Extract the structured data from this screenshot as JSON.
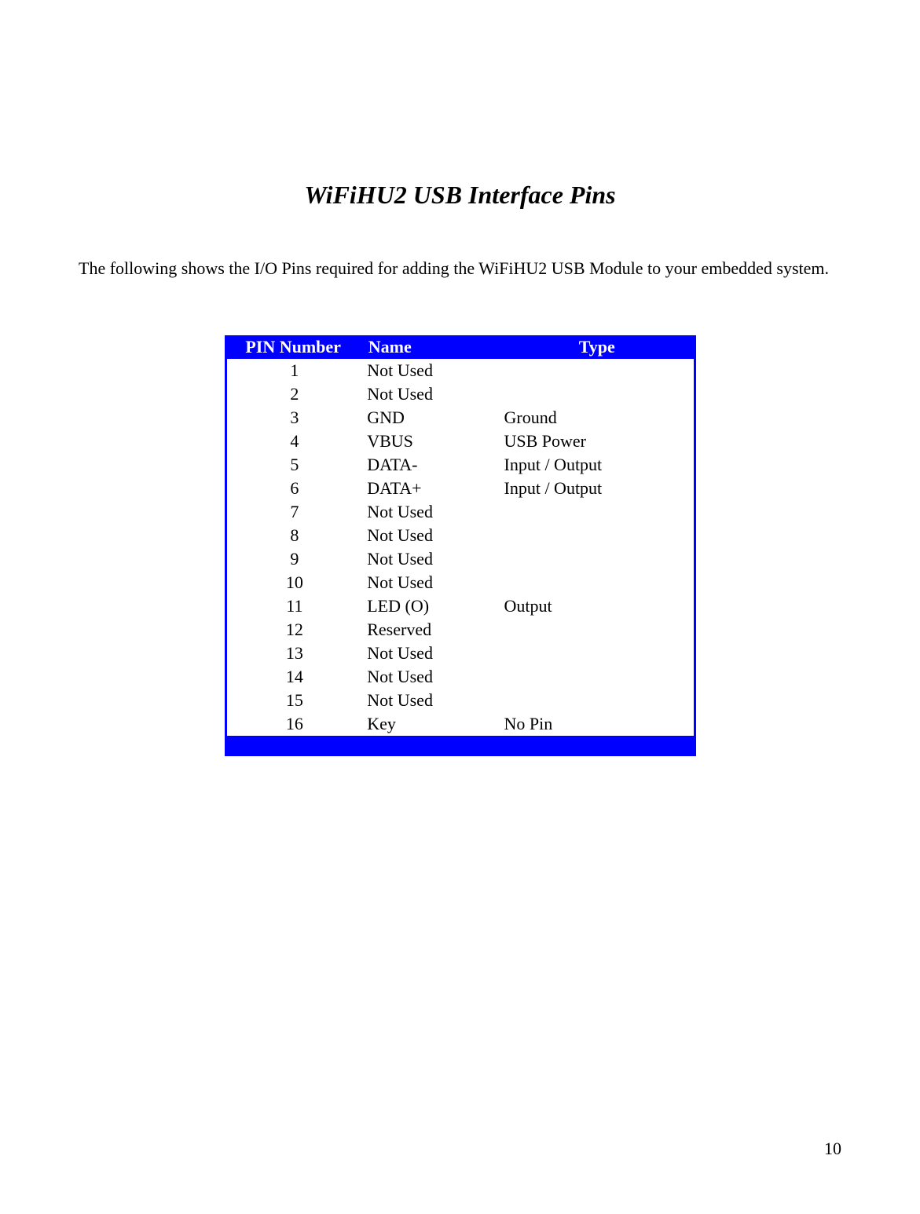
{
  "title": "WiFiHU2 USB Interface Pins",
  "intro": "The following shows the I/O Pins required for adding the WiFiHU2 USB Module to your embedded system.",
  "table": {
    "headers": {
      "pin": "PIN Number",
      "name": "Name",
      "type": "Type"
    },
    "rows": [
      {
        "pin": "1",
        "name": "Not Used",
        "type": ""
      },
      {
        "pin": "2",
        "name": "Not Used",
        "type": ""
      },
      {
        "pin": "3",
        "name": "GND",
        "type": "Ground"
      },
      {
        "pin": "4",
        "name": "VBUS",
        "type": "USB Power"
      },
      {
        "pin": "5",
        "name": "DATA-",
        "type": "Input / Output"
      },
      {
        "pin": "6",
        "name": "DATA+",
        "type": "Input / Output"
      },
      {
        "pin": "7",
        "name": "Not Used",
        "type": ""
      },
      {
        "pin": "8",
        "name": "Not Used",
        "type": ""
      },
      {
        "pin": "9",
        "name": "Not Used",
        "type": ""
      },
      {
        "pin": "10",
        "name": "Not Used",
        "type": ""
      },
      {
        "pin": "11",
        "name": "LED (O)",
        "type": "Output"
      },
      {
        "pin": "12",
        "name": "Reserved",
        "type": ""
      },
      {
        "pin": "13",
        "name": "Not Used",
        "type": ""
      },
      {
        "pin": "14",
        "name": "Not Used",
        "type": ""
      },
      {
        "pin": "15",
        "name": "Not Used",
        "type": ""
      },
      {
        "pin": "16",
        "name": "Key",
        "type": "No Pin"
      }
    ]
  },
  "page_number": "10"
}
